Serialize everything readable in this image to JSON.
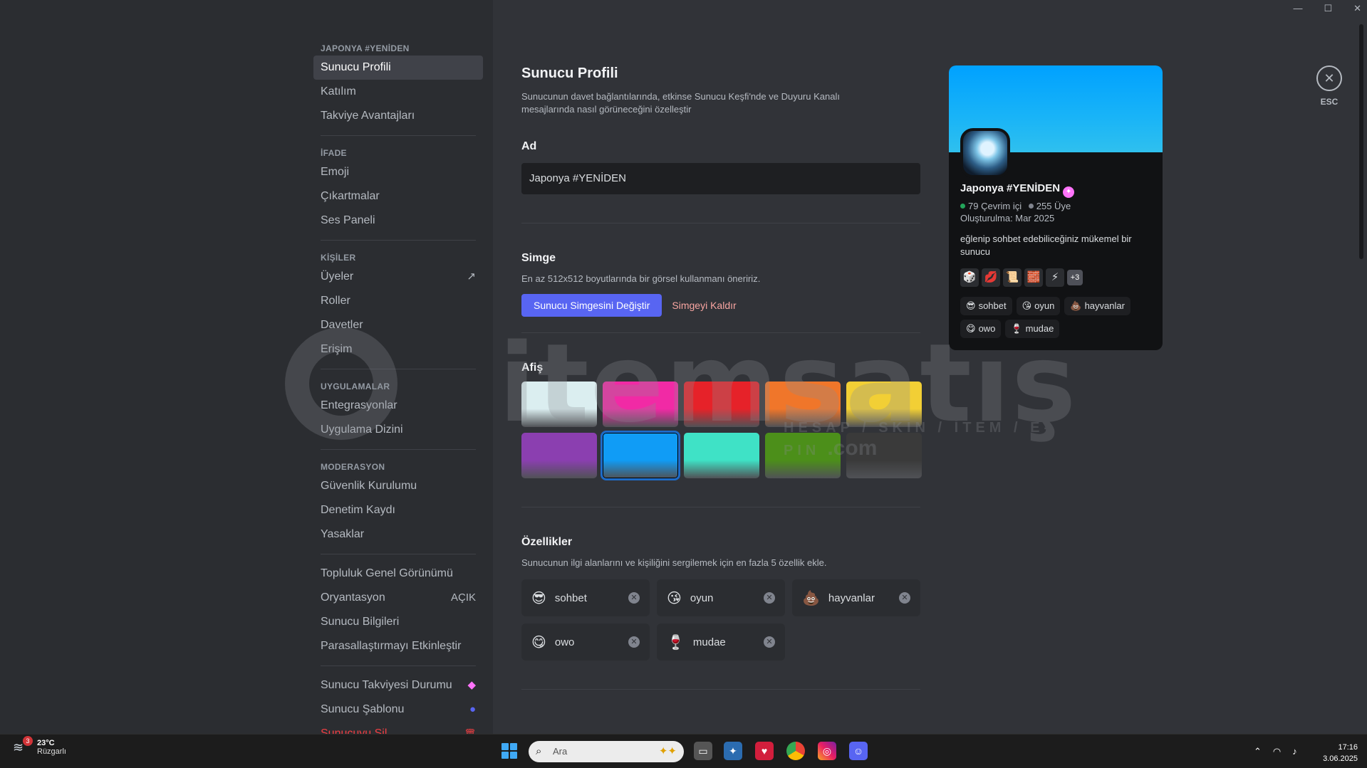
{
  "sidebar": {
    "sections": [
      {
        "header": "JAPONYA #YENİDEN",
        "items": [
          {
            "label": "Sunucu Profili",
            "active": true
          },
          {
            "label": "Katılım"
          },
          {
            "label": "Takviye Avantajları"
          }
        ]
      },
      {
        "header": "İFADE",
        "items": [
          {
            "label": "Emoji"
          },
          {
            "label": "Çıkartmalar"
          },
          {
            "label": "Ses Paneli"
          }
        ]
      },
      {
        "header": "KİŞİLER",
        "items": [
          {
            "label": "Üyeler",
            "icon": "external-link-icon"
          },
          {
            "label": "Roller"
          },
          {
            "label": "Davetler"
          },
          {
            "label": "Erişim"
          }
        ]
      },
      {
        "header": "UYGULAMALAR",
        "items": [
          {
            "label": "Entegrasyonlar"
          },
          {
            "label": "Uygulama Dizini"
          }
        ]
      },
      {
        "header": "MODERASYON",
        "items": [
          {
            "label": "Güvenlik Kurulumu"
          },
          {
            "label": "Denetim Kaydı"
          },
          {
            "label": "Yasaklar"
          }
        ]
      },
      {
        "header": "",
        "items": [
          {
            "label": "Topluluk Genel Görünümü"
          },
          {
            "label": "Oryantasyon",
            "right": "AÇIK"
          },
          {
            "label": "Sunucu Bilgileri"
          },
          {
            "label": "Parasallaştırmayı Etkinleştir"
          }
        ]
      },
      {
        "header": "",
        "items": [
          {
            "label": "Sunucu Takviyesi Durumu",
            "icon": "boost-gem-icon"
          },
          {
            "label": "Sunucu Şablonu",
            "icon": "blue-dot-icon"
          },
          {
            "label": "Sunucuyu Sil",
            "icon": "trash-icon",
            "danger": true
          }
        ]
      }
    ]
  },
  "main": {
    "title": "Sunucu Profili",
    "description": "Sunucunun davet bağlantılarında, etkinse Sunucu Keşfi'nde ve Duyuru Kanalı mesajlarında nasıl görüneceğini özelleştir",
    "name": {
      "label": "Ad",
      "value": "Japonya #YENİDEN"
    },
    "icon": {
      "label": "Simge",
      "hint": "En az 512x512 boyutlarında bir görsel kullanmanı öneririz.",
      "change_button": "Sunucu Simgesini Değiştir",
      "remove_link": "Simgeyi Kaldır"
    },
    "banner": {
      "label": "Afiş",
      "selected_index": 6,
      "swatches": [
        "#dbeef0",
        "#f12aa5",
        "#e62229",
        "#f0762a",
        "#f2cf35",
        "#8b3fb0",
        "#109cf6",
        "#3fe2c6",
        "#4c8f1a",
        "#3a3a3a"
      ]
    },
    "traits": {
      "label": "Özellikler",
      "hint": "Sunucunun ilgi alanlarını ve kişiliğini sergilemek için en fazla 5 özellik ekle.",
      "items": [
        {
          "emoji": "😎",
          "text": "sohbet"
        },
        {
          "emoji": "😘",
          "text": "oyun"
        },
        {
          "emoji": "💩",
          "text": "hayvanlar"
        },
        {
          "emoji": "😋",
          "text": "owo"
        },
        {
          "emoji": "🍷",
          "text": "mudae"
        }
      ]
    }
  },
  "card": {
    "name": "Japonya #YENİDEN",
    "online": "79 Çevrim içi",
    "members": "255 Üye",
    "created": "Oluşturulma: Mar 2025",
    "description": "eğlenip sohbet edebiliceğiniz mükemel bir sunucu",
    "emojis": [
      "🎲",
      "💋",
      "📜",
      "🧱",
      "⚡"
    ],
    "more": "+3",
    "traits": [
      {
        "emoji": "😎",
        "text": "sohbet"
      },
      {
        "emoji": "😘",
        "text": "oyun"
      },
      {
        "emoji": "💩",
        "text": "hayvanlar"
      },
      {
        "emoji": "😋",
        "text": "owo"
      },
      {
        "emoji": "🍷",
        "text": "mudae"
      }
    ]
  },
  "close": {
    "esc": "ESC"
  },
  "watermark": {
    "text": "itemsatış",
    "sub": "HESAP / SKIN / İTEM / E-PIN",
    "dotcom": ".com"
  },
  "taskbar": {
    "weather": {
      "badge": "3",
      "temp": "23°C",
      "cond": "Rüzgarlı"
    },
    "search_placeholder": "Ara",
    "time": "17:16",
    "date": "3.06.2025"
  },
  "colors": {
    "accent": "#5865f2",
    "danger": "#f23f43",
    "online": "#23a55a"
  }
}
